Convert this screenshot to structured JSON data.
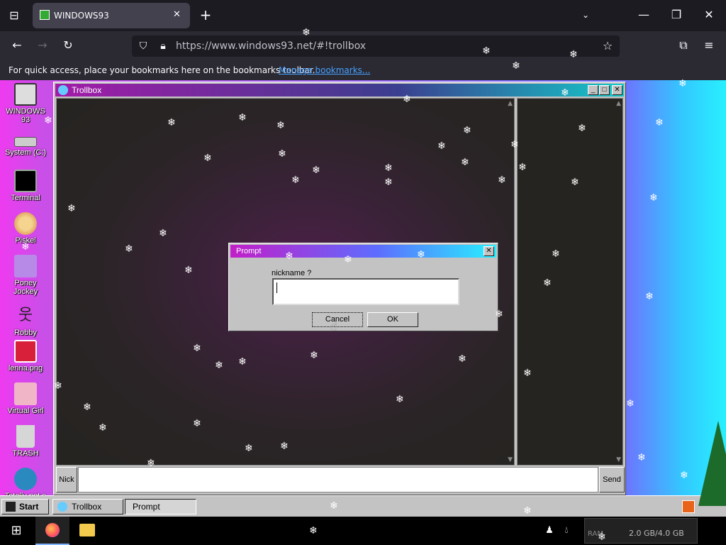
{
  "browser": {
    "tab_title": "WINDOWS93",
    "tab_close": "✕",
    "new_tab": "+",
    "url": "https://www.windows93.net/#!trollbox",
    "bookmarks_hint": "For quick access, place your bookmarks here on the bookmarks toolbar.",
    "manage_bookmarks": "Manage bookmarks..."
  },
  "desktop": {
    "icons": [
      {
        "label": "WINDOWS 93",
        "icon": "computer-icon"
      },
      {
        "label": "System (C:)",
        "icon": "drive-icon"
      },
      {
        "label": "Terminal",
        "icon": "terminal-icon"
      },
      {
        "label": "Piskel",
        "icon": "palette-icon"
      },
      {
        "label": "Poney Jockey",
        "icon": "pony-icon"
      },
      {
        "label": "Robby",
        "icon": "stickman-icon"
      },
      {
        "label": "lenna.png",
        "icon": "image-icon"
      },
      {
        "label": "Virtual Girl",
        "icon": "girl-icon"
      },
      {
        "label": "TRASH",
        "icon": "trash-icon"
      },
      {
        "label": "Totally not a",
        "icon": "dolphin-icon"
      }
    ]
  },
  "trollbox": {
    "title": "Trollbox",
    "nick_label": "Nick",
    "send_label": "Send",
    "message_value": ""
  },
  "prompt": {
    "title": "Prompt",
    "label": "nickname ?",
    "value": "",
    "cancel_label": "Cancel",
    "ok_label": "OK"
  },
  "w93taskbar": {
    "start_label": "Start",
    "items": [
      "Trollbox",
      "Prompt"
    ]
  },
  "system_tray": {
    "ram_label": "RAM",
    "ram_value": "2.0 GB/4.0 GB"
  }
}
